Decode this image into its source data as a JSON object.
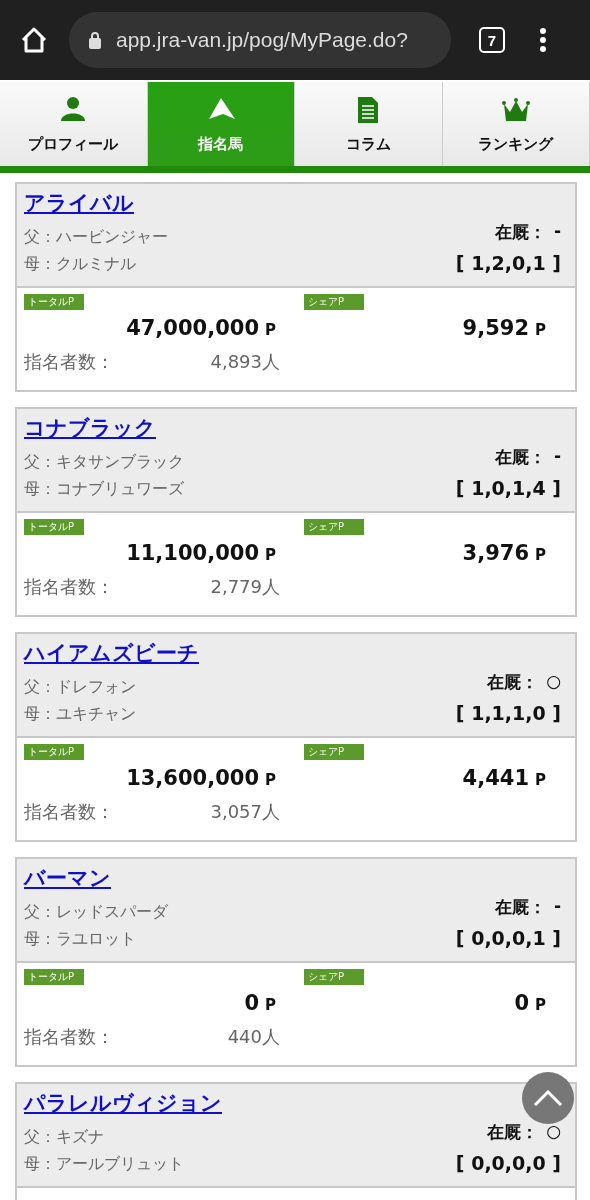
{
  "browser": {
    "url": "app.jra-van.jp/pog/MyPage.do?",
    "tab_count": "7"
  },
  "tabs": [
    {
      "label": "プロフィール",
      "selected": false
    },
    {
      "label": "指名馬",
      "selected": true
    },
    {
      "label": "コラム",
      "selected": false
    },
    {
      "label": "ランキング",
      "selected": false
    }
  ],
  "horses": [
    {
      "name": "アライバル",
      "sire": "父：ハービンジャー",
      "dam": "母：クルミナル",
      "stable_label": "在厩：",
      "stable": "-",
      "record": "[ 1,2,0,1 ]",
      "total_tag": "トータルP",
      "total": "47,000,000",
      "total_unit": "P",
      "share_tag": "シェアP",
      "share": "9,592",
      "share_unit": "P",
      "count_label": "指名者数：",
      "count": "4,893人"
    },
    {
      "name": "コナブラック",
      "sire": "父：キタサンブラック",
      "dam": "母：コナブリュワーズ",
      "stable_label": "在厩：",
      "stable": "-",
      "record": "[ 1,0,1,4 ]",
      "total_tag": "トータルP",
      "total": "11,100,000",
      "total_unit": "P",
      "share_tag": "シェアP",
      "share": "3,976",
      "share_unit": "P",
      "count_label": "指名者数：",
      "count": "2,779人"
    },
    {
      "name": "ハイアムズビーチ",
      "sire": "父：ドレフォン",
      "dam": "母：ユキチャン",
      "stable_label": "在厩：",
      "stable": "○",
      "record": "[ 1,1,1,0 ]",
      "total_tag": "トータルP",
      "total": "13,600,000",
      "total_unit": "P",
      "share_tag": "シェアP",
      "share": "4,441",
      "share_unit": "P",
      "count_label": "指名者数：",
      "count": "3,057人"
    },
    {
      "name": "バーマン",
      "sire": "父：レッドスパーダ",
      "dam": "母：ラユロット",
      "stable_label": "在厩：",
      "stable": "-",
      "record": "[ 0,0,0,1 ]",
      "total_tag": "トータルP",
      "total": "0",
      "total_unit": "P",
      "share_tag": "シェアP",
      "share": "0",
      "share_unit": "P",
      "count_label": "指名者数：",
      "count": "440人"
    },
    {
      "name": "パラレルヴィジョン",
      "sire": "父：キズナ",
      "dam": "母：アールブリュット",
      "stable_label": "在厩：",
      "stable": "○",
      "record": "[ 0,0,0,0 ]"
    }
  ]
}
